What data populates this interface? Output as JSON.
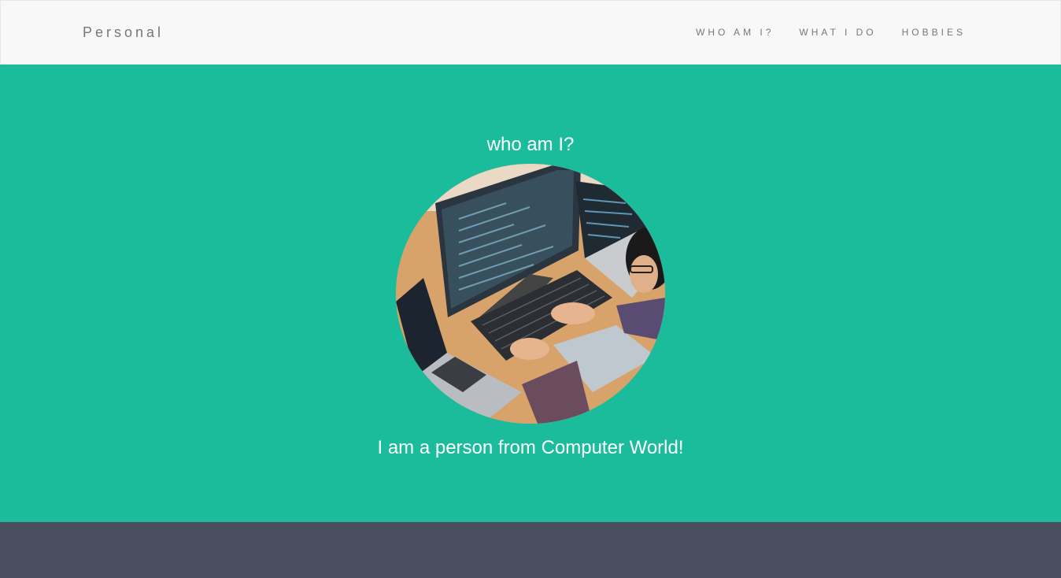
{
  "navbar": {
    "brand": "Personal",
    "links": [
      "WHO AM I?",
      "WHAT I DO",
      "HOBBIES"
    ]
  },
  "hero": {
    "title": "who am I?",
    "image_alt": "person coding at computer",
    "caption": "I am a person from Computer World!"
  },
  "colors": {
    "navbar_bg": "#f8f8f8",
    "hero_bg": "#1abc9c",
    "footer_bg": "#4a4f5f",
    "nav_text": "#777777"
  }
}
